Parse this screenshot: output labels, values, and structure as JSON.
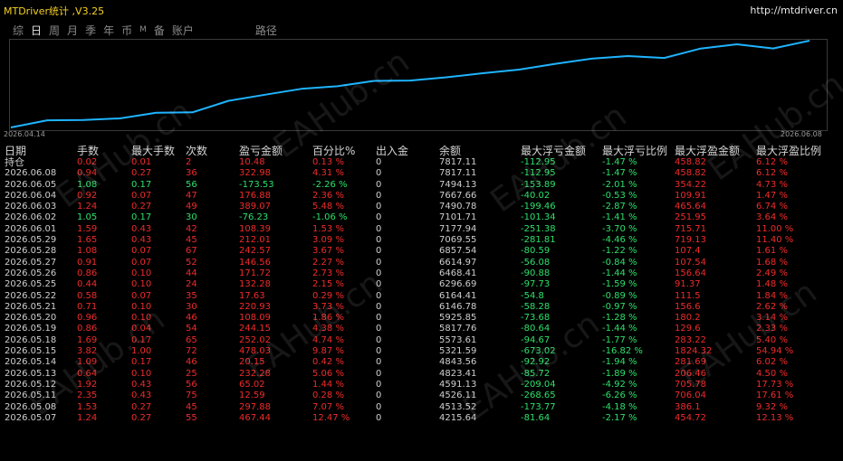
{
  "window": {
    "title": "MTDriver统计 ,V3.25",
    "url": "http://mtdriver.cn"
  },
  "tabs": [
    "综",
    "日",
    "周",
    "月",
    "季",
    "年",
    "币",
    "M",
    "备",
    "账户",
    "路径"
  ],
  "active_tab": "日",
  "chart": {
    "start_date": "2026.04.14",
    "end_date": "2026.06.08",
    "line_color": "#1fb4ff",
    "balances": [
      4215.64,
      4513.52,
      4526.11,
      4591.13,
      4823.41,
      4843.56,
      5321.59,
      5573.61,
      5817.76,
      5925.85,
      6146.78,
      6164.41,
      6296.69,
      6468.41,
      6614.97,
      6857.54,
      7069.55,
      7177.94,
      7101.71,
      7490.78,
      7667.66,
      7494.13,
      7817.11
    ]
  },
  "table": {
    "headers": [
      "日期",
      "手数",
      "最大手数",
      "次数",
      "盈亏金额",
      "百分比%",
      "出入金",
      "余额",
      "最大浮亏金额",
      "最大浮亏比例",
      "最大浮盈金额",
      "最大浮盈比例"
    ],
    "holding_label": "持仓",
    "rows": [
      {
        "date": "2026.06.08",
        "lots": "0.94",
        "max_lots": "0.27",
        "count": "36",
        "pnl": "322.98",
        "pct": "4.31 %",
        "dw": "0",
        "balance": "7817.11",
        "max_dd": "-112.95",
        "max_dd_pct": "-1.47 %",
        "max_fp": "458.82",
        "max_fp_pct": "6.12 %",
        "sign": "pos"
      },
      {
        "date": "2026.06.05",
        "lots": "1.08",
        "max_lots": "0.17",
        "count": "56",
        "pnl": "-173.53",
        "pct": "-2.26 %",
        "dw": "0",
        "balance": "7494.13",
        "max_dd": "-153.89",
        "max_dd_pct": "-2.01 %",
        "max_fp": "354.22",
        "max_fp_pct": "4.73 %",
        "sign": "neg"
      },
      {
        "date": "2026.06.04",
        "lots": "0.92",
        "max_lots": "0.07",
        "count": "47",
        "pnl": "176.88",
        "pct": "2.36 %",
        "dw": "0",
        "balance": "7667.66",
        "max_dd": "-40.02",
        "max_dd_pct": "-0.53 %",
        "max_fp": "109.91",
        "max_fp_pct": "1.47 %",
        "sign": "pos"
      },
      {
        "date": "2026.06.03",
        "lots": "1.24",
        "max_lots": "0.27",
        "count": "49",
        "pnl": "389.07",
        "pct": "5.48 %",
        "dw": "0",
        "balance": "7490.78",
        "max_dd": "-199.46",
        "max_dd_pct": "-2.87 %",
        "max_fp": "465.64",
        "max_fp_pct": "6.74 %",
        "sign": "pos"
      },
      {
        "date": "2026.06.02",
        "lots": "1.05",
        "max_lots": "0.17",
        "count": "30",
        "pnl": "-76.23",
        "pct": "-1.06 %",
        "dw": "0",
        "balance": "7101.71",
        "max_dd": "-101.34",
        "max_dd_pct": "-1.41 %",
        "max_fp": "251.95",
        "max_fp_pct": "3.64 %",
        "sign": "neg"
      },
      {
        "date": "2026.06.01",
        "lots": "1.59",
        "max_lots": "0.43",
        "count": "42",
        "pnl": "108.39",
        "pct": "1.53 %",
        "dw": "0",
        "balance": "7177.94",
        "max_dd": "-251.38",
        "max_dd_pct": "-3.70 %",
        "max_fp": "715.71",
        "max_fp_pct": "11.00 %",
        "sign": "pos"
      },
      {
        "date": "2026.05.29",
        "lots": "1.65",
        "max_lots": "0.43",
        "count": "45",
        "pnl": "212.01",
        "pct": "3.09 %",
        "dw": "0",
        "balance": "7069.55",
        "max_dd": "-281.81",
        "max_dd_pct": "-4.46 %",
        "max_fp": "719.13",
        "max_fp_pct": "11.40 %",
        "sign": "pos"
      },
      {
        "date": "2026.05.28",
        "lots": "1.08",
        "max_lots": "0.07",
        "count": "67",
        "pnl": "242.57",
        "pct": "3.67 %",
        "dw": "0",
        "balance": "6857.54",
        "max_dd": "-80.59",
        "max_dd_pct": "-1.22 %",
        "max_fp": "107.4",
        "max_fp_pct": "1.61 %",
        "sign": "pos"
      },
      {
        "date": "2026.05.27",
        "lots": "0.91",
        "max_lots": "0.07",
        "count": "52",
        "pnl": "146.56",
        "pct": "2.27 %",
        "dw": "0",
        "balance": "6614.97",
        "max_dd": "-56.08",
        "max_dd_pct": "-0.84 %",
        "max_fp": "107.54",
        "max_fp_pct": "1.68 %",
        "sign": "pos"
      },
      {
        "date": "2026.05.26",
        "lots": "0.86",
        "max_lots": "0.10",
        "count": "44",
        "pnl": "171.72",
        "pct": "2.73 %",
        "dw": "0",
        "balance": "6468.41",
        "max_dd": "-90.88",
        "max_dd_pct": "-1.44 %",
        "max_fp": "156.64",
        "max_fp_pct": "2.49 %",
        "sign": "pos"
      },
      {
        "date": "2026.05.25",
        "lots": "0.44",
        "max_lots": "0.10",
        "count": "24",
        "pnl": "132.28",
        "pct": "2.15 %",
        "dw": "0",
        "balance": "6296.69",
        "max_dd": "-97.73",
        "max_dd_pct": "-1.59 %",
        "max_fp": "91.37",
        "max_fp_pct": "1.48 %",
        "sign": "pos"
      },
      {
        "date": "2026.05.22",
        "lots": "0.58",
        "max_lots": "0.07",
        "count": "35",
        "pnl": "17.63",
        "pct": "0.29 %",
        "dw": "0",
        "balance": "6164.41",
        "max_dd": "-54.8",
        "max_dd_pct": "-0.89 %",
        "max_fp": "111.5",
        "max_fp_pct": "1.84 %",
        "sign": "pos"
      },
      {
        "date": "2026.05.21",
        "lots": "0.71",
        "max_lots": "0.10",
        "count": "30",
        "pnl": "220.93",
        "pct": "3.73 %",
        "dw": "0",
        "balance": "6146.78",
        "max_dd": "-58.28",
        "max_dd_pct": "-0.97 %",
        "max_fp": "156.6",
        "max_fp_pct": "2.62 %",
        "sign": "pos"
      },
      {
        "date": "2026.05.20",
        "lots": "0.96",
        "max_lots": "0.10",
        "count": "46",
        "pnl": "108.09",
        "pct": "1.86 %",
        "dw": "0",
        "balance": "5925.85",
        "max_dd": "-73.68",
        "max_dd_pct": "-1.28 %",
        "max_fp": "180.2",
        "max_fp_pct": "3.14 %",
        "sign": "pos"
      },
      {
        "date": "2026.05.19",
        "lots": "0.86",
        "max_lots": "0.04",
        "count": "54",
        "pnl": "244.15",
        "pct": "4.38 %",
        "dw": "0",
        "balance": "5817.76",
        "max_dd": "-80.64",
        "max_dd_pct": "-1.44 %",
        "max_fp": "129.6",
        "max_fp_pct": "2.33 %",
        "sign": "pos"
      },
      {
        "date": "2026.05.18",
        "lots": "1.69",
        "max_lots": "0.17",
        "count": "65",
        "pnl": "252.02",
        "pct": "4.74 %",
        "dw": "0",
        "balance": "5573.61",
        "max_dd": "-94.67",
        "max_dd_pct": "-1.77 %",
        "max_fp": "283.22",
        "max_fp_pct": "5.40 %",
        "sign": "pos"
      },
      {
        "date": "2026.05.15",
        "lots": "3.82",
        "max_lots": "1.00",
        "count": "72",
        "pnl": "478.03",
        "pct": "9.87 %",
        "dw": "0",
        "balance": "5321.59",
        "max_dd": "-673.02",
        "max_dd_pct": "-16.82 %",
        "max_fp": "1824.32",
        "max_fp_pct": "54.94 %",
        "sign": "pos"
      },
      {
        "date": "2026.05.14",
        "lots": "1.09",
        "max_lots": "0.17",
        "count": "46",
        "pnl": "20.15",
        "pct": "0.42 %",
        "dw": "0",
        "balance": "4843.56",
        "max_dd": "-92.92",
        "max_dd_pct": "-1.94 %",
        "max_fp": "281.69",
        "max_fp_pct": "6.02 %",
        "sign": "pos"
      },
      {
        "date": "2026.05.13",
        "lots": "0.64",
        "max_lots": "0.10",
        "count": "25",
        "pnl": "232.28",
        "pct": "5.06 %",
        "dw": "0",
        "balance": "4823.41",
        "max_dd": "-85.72",
        "max_dd_pct": "-1.89 %",
        "max_fp": "206.46",
        "max_fp_pct": "4.50 %",
        "sign": "pos"
      },
      {
        "date": "2026.05.12",
        "lots": "1.92",
        "max_lots": "0.43",
        "count": "56",
        "pnl": "65.02",
        "pct": "1.44 %",
        "dw": "0",
        "balance": "4591.13",
        "max_dd": "-209.04",
        "max_dd_pct": "-4.92 %",
        "max_fp": "705.78",
        "max_fp_pct": "17.73 %",
        "sign": "pos"
      },
      {
        "date": "2026.05.11",
        "lots": "2.35",
        "max_lots": "0.43",
        "count": "75",
        "pnl": "12.59",
        "pct": "0.28 %",
        "dw": "0",
        "balance": "4526.11",
        "max_dd": "-268.65",
        "max_dd_pct": "-6.26 %",
        "max_fp": "706.04",
        "max_fp_pct": "17.61 %",
        "sign": "pos"
      },
      {
        "date": "2026.05.08",
        "lots": "1.53",
        "max_lots": "0.27",
        "count": "45",
        "pnl": "297.88",
        "pct": "7.07 %",
        "dw": "0",
        "balance": "4513.52",
        "max_dd": "-173.77",
        "max_dd_pct": "-4.18 %",
        "max_fp": "386.1",
        "max_fp_pct": "9.32 %",
        "sign": "pos"
      },
      {
        "date": "2026.05.07",
        "lots": "1.24",
        "max_lots": "0.27",
        "count": "55",
        "pnl": "467.44",
        "pct": "12.47 %",
        "dw": "0",
        "balance": "4215.64",
        "max_dd": "-81.64",
        "max_dd_pct": "-2.17 %",
        "max_fp": "454.72",
        "max_fp_pct": "12.13 %",
        "sign": "pos"
      }
    ],
    "holding": {
      "lots": "0.02",
      "max_lots": "0.01",
      "count": "2",
      "pnl": "10.48",
      "pct": "0.13 %",
      "dw": "0",
      "balance": "7817.11",
      "max_dd": "-112.95",
      "max_dd_pct": "-1.47 %",
      "max_fp": "458.82",
      "max_fp_pct": "6.12 %"
    }
  },
  "watermark": "EAHub.cn",
  "colors": {
    "positive": "#ef2b2b",
    "negative": "#2ee06a",
    "neutral": "#cfcfcf",
    "title": "#f5d020"
  }
}
